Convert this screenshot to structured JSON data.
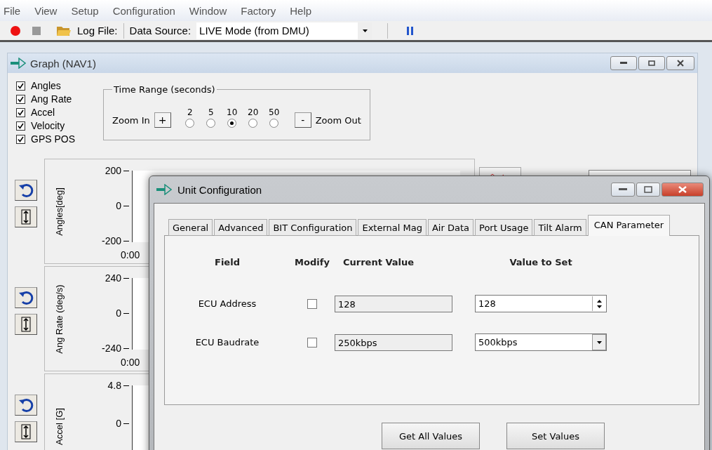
{
  "menu": [
    "File",
    "View",
    "Setup",
    "Configuration",
    "Window",
    "Factory",
    "Help"
  ],
  "toolbar": {
    "log_label": "Log File:",
    "source_label": "Data Source:",
    "source_value": "LIVE Mode (from DMU)"
  },
  "graph_window": {
    "title": "Graph (NAV1)",
    "series_checks": [
      {
        "label": "Angles",
        "checked": true
      },
      {
        "label": "Ang Rate",
        "checked": true
      },
      {
        "label": "Accel",
        "checked": true
      },
      {
        "label": "Velocity",
        "checked": true
      },
      {
        "label": "GPS POS",
        "checked": true
      }
    ],
    "time_range": {
      "title": "Time Range (seconds)",
      "zoom_in": "Zoom In",
      "plus": "+",
      "minus": "-",
      "zoom_out": "Zoom Out",
      "options": [
        {
          "label": "2",
          "selected": false
        },
        {
          "label": "5",
          "selected": false
        },
        {
          "label": "10",
          "selected": true
        },
        {
          "label": "20",
          "selected": false
        },
        {
          "label": "50",
          "selected": false
        }
      ]
    },
    "panels": [
      {
        "ylabel": "Angles[deg]",
        "yticks": [
          "200",
          "0",
          "-200"
        ],
        "xtick": "0:00"
      },
      {
        "ylabel": "Ang Rate (deg/s)",
        "yticks": [
          "240",
          "0",
          "-240"
        ],
        "xtick": "0:00"
      },
      {
        "ylabel": "Accel [G]",
        "yticks": [
          "4.8",
          "0"
        ]
      }
    ]
  },
  "dialog": {
    "title": "Unit Configuration",
    "tabs": [
      {
        "label": "General",
        "selected": false
      },
      {
        "label": "Advanced",
        "selected": false
      },
      {
        "label": "BIT Configuration",
        "selected": false
      },
      {
        "label": "External Mag",
        "selected": false
      },
      {
        "label": "Air Data",
        "selected": false
      },
      {
        "label": "Port Usage",
        "selected": false
      },
      {
        "label": "Tilt Alarm",
        "selected": false
      },
      {
        "label": "CAN Parameter",
        "selected": true
      }
    ],
    "columns": [
      "Field",
      "Modify",
      "Current Value",
      "Value to Set"
    ],
    "rows": [
      {
        "field": "ECU Address",
        "modify": false,
        "current": "128",
        "value": "128",
        "kind": "spin"
      },
      {
        "field": "ECU Baudrate",
        "modify": false,
        "current": "250kbps",
        "value": "500kbps",
        "kind": "dropdown"
      }
    ],
    "buttons": [
      "Get All Values",
      "Set Values"
    ]
  }
}
